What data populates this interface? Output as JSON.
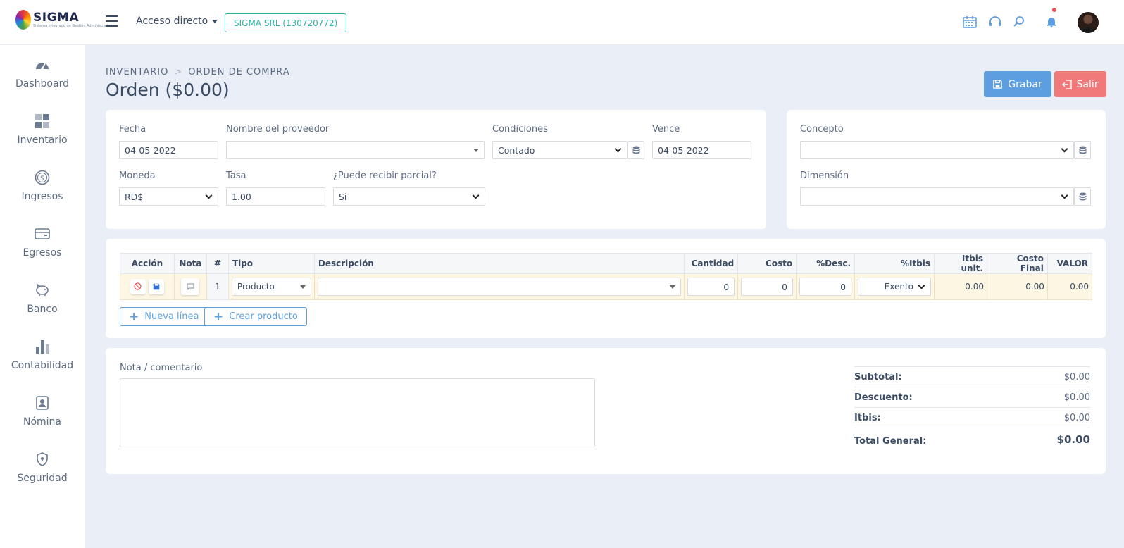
{
  "header": {
    "logo_text": "SIGMA",
    "logo_sub": "Sistema Integrado de Gestión Administrativa",
    "quick_access_label": "Acceso directo",
    "company_label": "SIGMA SRL (130720772)",
    "icons": [
      "calendar-icon",
      "headset-icon",
      "search-icon",
      "bell-icon",
      "user-avatar"
    ]
  },
  "sidebar": {
    "items": [
      {
        "label": "Dashboard",
        "icon": "dashboard-icon"
      },
      {
        "label": "Inventario",
        "icon": "grid-icon"
      },
      {
        "label": "Ingresos",
        "icon": "dollar-icon"
      },
      {
        "label": "Egresos",
        "icon": "wallet-icon"
      },
      {
        "label": "Banco",
        "icon": "piggy-bank-icon"
      },
      {
        "label": "Contabilidad",
        "icon": "bar-chart-icon"
      },
      {
        "label": "Nómina",
        "icon": "id-badge-icon"
      },
      {
        "label": "Seguridad",
        "icon": "shield-icon"
      }
    ]
  },
  "breadcrumb": {
    "root": "INVENTARIO",
    "current": "ORDEN DE COMPRA"
  },
  "page_title": "Orden ($0.00)",
  "actions": {
    "save_label": "Grabar",
    "exit_label": "Salir"
  },
  "form": {
    "fecha": {
      "label": "Fecha",
      "value": "04-05-2022"
    },
    "proveedor": {
      "label": "Nombre del proveedor",
      "value": ""
    },
    "condiciones": {
      "label": "Condiciones",
      "value": "Contado"
    },
    "vence": {
      "label": "Vence",
      "value": "04-05-2022"
    },
    "moneda": {
      "label": "Moneda",
      "value": "RD$"
    },
    "tasa": {
      "label": "Tasa",
      "value": "1.00"
    },
    "parcial": {
      "label": "¿Puede recibir parcial?",
      "value": "Si"
    },
    "concepto": {
      "label": "Concepto",
      "value": ""
    },
    "dimension": {
      "label": "Dimensión",
      "value": ""
    }
  },
  "table": {
    "headers": [
      "Acción",
      "Nota",
      "#",
      "Tipo",
      "Descripción",
      "Cantidad",
      "Costo",
      "%Desc.",
      "%Itbis",
      "Itbis unit.",
      "Costo Final",
      "VALOR"
    ],
    "rows": [
      {
        "num": "1",
        "tipo": "Producto",
        "descripcion": "",
        "cantidad": "0",
        "costo": "0",
        "desc": "0",
        "itbis": "Exento",
        "itbis_unit": "0.00",
        "costo_final": "0.00",
        "valor": "0.00"
      }
    ]
  },
  "line_actions": {
    "new_line": "Nueva línea",
    "create_product": "Crear producto"
  },
  "notes": {
    "label": "Nota / comentario",
    "value": ""
  },
  "totals": {
    "subtotal": {
      "label": "Subtotal:",
      "value": "$0.00"
    },
    "descuento": {
      "label": "Descuento:",
      "value": "$0.00"
    },
    "itbis": {
      "label": "Itbis:",
      "value": "$0.00"
    },
    "total": {
      "label": "Total General:",
      "value": "$0.00"
    }
  },
  "colors": {
    "primary": "#5c9ee0",
    "danger": "#f07a7a",
    "teal": "#2bb5a6",
    "background": "#e9eef7"
  }
}
